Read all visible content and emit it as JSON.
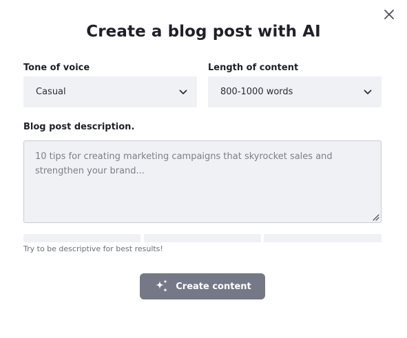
{
  "dialog": {
    "title": "Create a blog post with AI",
    "close_icon": "close-icon"
  },
  "tone": {
    "label": "Tone of voice",
    "value": "Casual",
    "icon": "chevron-down-icon"
  },
  "length": {
    "label": "Length of content",
    "value": "800-1000 words",
    "icon": "chevron-down-icon"
  },
  "description": {
    "label": "Blog post description.",
    "placeholder": "10 tips for creating marketing campaigns that skyrocket sales and strengthen your brand...",
    "hint": "Try to be descriptive for best results!",
    "resize_icon": "resize-grip-icon"
  },
  "actions": {
    "create_label": "Create content",
    "create_icon": "sparkles-icon"
  },
  "colors": {
    "field_bg": "#f0f1f5",
    "button_bg": "#757886",
    "text": "#1f2028"
  }
}
